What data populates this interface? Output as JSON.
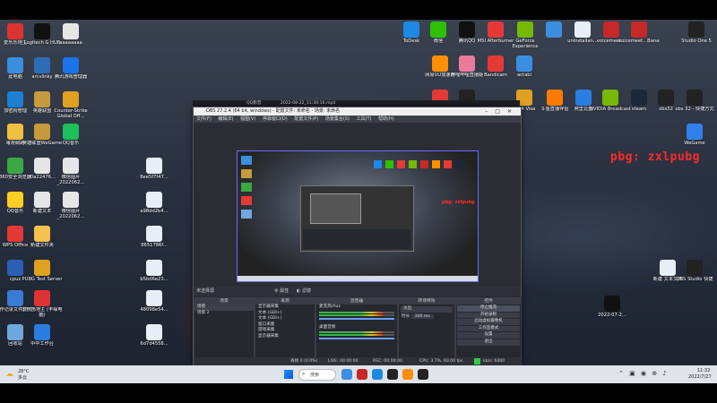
{
  "desktop_icons_left": [
    {
      "label": "爱乐乐地主",
      "color": "#d33"
    },
    {
      "label": "此电脑",
      "color": "#3a8fe0"
    },
    {
      "label": "加密狗管理",
      "color": "#1b7fd4"
    },
    {
      "label": "電視網路",
      "color": "#f0c040"
    },
    {
      "label": "360安全浏览器",
      "color": "#3ca843"
    },
    {
      "label": "QQ音乐",
      "color": "#ffcf26"
    },
    {
      "label": "WPS Office",
      "color": "#e53935"
    },
    {
      "label": "cpuz",
      "color": "#2c5fb2"
    },
    {
      "label": "操作记录文件(存在)",
      "color": "#3a7bd5"
    },
    {
      "label": "回收站",
      "color": "#6fa8dc"
    }
  ],
  "desktop_icons_col2": [
    {
      "label": "Logitech G HUB",
      "color": "#111"
    },
    {
      "label": "arcvlinky",
      "color": "#2d6db5"
    },
    {
      "label": "英雄联盟",
      "color": "#c59b3c"
    },
    {
      "label": "英雄联盟WeGame",
      "color": "#c59b3c"
    },
    {
      "label": "f0a22476...",
      "color": "#e6e6e6"
    },
    {
      "label": "新建文本",
      "color": "#e6e6e6"
    },
    {
      "label": "新建文件夹",
      "color": "#f2c14e"
    },
    {
      "label": "PUBG Test Server",
      "color": "#e0a020"
    },
    {
      "label": "爱乐乐地主 (丰缘电脑)",
      "color": "#d33"
    },
    {
      "label": "中中工作台",
      "color": "#2a7de1"
    }
  ],
  "desktop_icons_col3": [
    {
      "label": "aaaaaaaa",
      "color": "#e6e6e6"
    },
    {
      "label": "腾讯游戏管理器",
      "color": "#1a73e8"
    },
    {
      "label": "Counter-Strike Global Off...",
      "color": "#e0a020"
    },
    {
      "label": "QQ音乐",
      "color": "#1dbf5a"
    },
    {
      "label": "微信图片_2022062...",
      "color": "#e6e6e6"
    },
    {
      "label": "微信图片_2022062...",
      "color": "#e6e6e6"
    }
  ],
  "desktop_icons_center": [
    {
      "label": "8ee5f7f47...",
      "color": "#e8eef6"
    },
    {
      "label": "a98dd2b4...",
      "color": "#e8eef6"
    },
    {
      "label": "8651786f...",
      "color": "#e8eef6"
    },
    {
      "label": "b5bd6e23...",
      "color": "#e8eef6"
    },
    {
      "label": "48098e54...",
      "color": "#e8eef6"
    },
    {
      "label": "6d7d4558...",
      "color": "#e8eef6"
    }
  ],
  "desktop_icons_top": [
    {
      "label": "ToDesk",
      "color": "#1e88e5"
    },
    {
      "label": "微信",
      "color": "#2dc100"
    },
    {
      "label": "腾讯QQ",
      "color": "#111"
    },
    {
      "label": "MSI Afterburner",
      "color": "#e53935"
    },
    {
      "label": "GeForce Experience",
      "color": "#76b900"
    },
    {
      "label": "",
      "color": "#3a8fe0"
    },
    {
      "label": "uninstallan...",
      "color": "#e8eef6"
    },
    {
      "label": "voicemeet...",
      "color": "#c62828"
    },
    {
      "label": "voicemeet...Banana",
      "color": "#c62828"
    },
    {
      "label": "Studio One 5",
      "color": "#222"
    }
  ],
  "desktop_icons_right": [
    {
      "label": "网易UU加速器",
      "color": "#ff8f00"
    },
    {
      "label": "哔哩哔哩直播姬",
      "color": "#ea7a99"
    },
    {
      "label": "Bandicam",
      "color": "#e53935"
    },
    {
      "label": "actabi",
      "color": "#3a8fe0"
    },
    {
      "label": "网易云音乐",
      "color": "#e53935"
    },
    {
      "label": "obs",
      "color": "#222"
    },
    {
      "label": "AB 4 Visa",
      "color": "#e0a020"
    },
    {
      "label": "斗鱼直播伴侣",
      "color": "#ff7a00"
    },
    {
      "label": "阿里云盘",
      "color": "#2a7de1"
    },
    {
      "label": "NVIDIA Broadcast",
      "color": "#76b900"
    },
    {
      "label": "steam",
      "color": "#1b2838"
    },
    {
      "label": "obs32",
      "color": "#222"
    },
    {
      "label": "obs 32 - 快捷方式",
      "color": "#222"
    },
    {
      "label": "WeGame",
      "color": "#2f80ed"
    }
  ],
  "desktop_icons_right_low": [
    {
      "label": "新建 文本文档",
      "color": "#e8eef6"
    },
    {
      "label": "OBS Studio 快捷",
      "color": "#222"
    },
    {
      "label": "2022-07-2...",
      "color": "#111"
    }
  ],
  "overlay_text": "pbg:  zxlpubg",
  "qq_window_title": "QQ影音",
  "qq_window_subtitle": "2022-08-22_11:30:16.mp4",
  "obs": {
    "title": "OBS 27.2.4 (64 bit, windows) - 配置文件: 未命名 - 场景: 未命名",
    "menu": [
      "文件(F)",
      "编辑(E)",
      "视图(V)",
      "停靠窗口(D)",
      "配置文件(P)",
      "场景集合(S)",
      "工具(T)",
      "帮助(H)"
    ],
    "source_bar": "未选择源",
    "source_bar_buttons": [
      "属性",
      "滤镜"
    ],
    "docks": {
      "scenes": {
        "title": "场景",
        "items": [
          "场景",
          "场景 2"
        ]
      },
      "sources": {
        "title": "来源",
        "items": [
          "显示器采集",
          "文本 (GDI+)",
          "文本 (GDI+)",
          "窗口采集",
          "游戏采集",
          "显示器采集"
        ]
      },
      "mixer": {
        "title": "混音器",
        "items": [
          "麦克风/Aux",
          "",
          "桌面音频"
        ]
      },
      "transitions": {
        "title": "转场特效",
        "type": "淡出",
        "duration_label": "时长",
        "duration": "300 ms"
      },
      "controls": {
        "title": "控件",
        "buttons": [
          "停止推流",
          "开始录制",
          "启动虚拟摄像机",
          "工作室模式",
          "设置",
          "退出"
        ]
      }
    },
    "status": {
      "dropped": "丢帧 0 (0.0%)",
      "live": "LIVE: 00:00:00",
      "rec": "REC: 00:00:00",
      "cpu": "CPU: 3.7%, 60.00 fps",
      "kbps": "kb/s: 6000"
    }
  },
  "taskbar": {
    "weather_temp": "28°C",
    "weather_desc": "多云",
    "search_placeholder": "搜索",
    "time": "11:32",
    "date": "2022/7/27"
  }
}
